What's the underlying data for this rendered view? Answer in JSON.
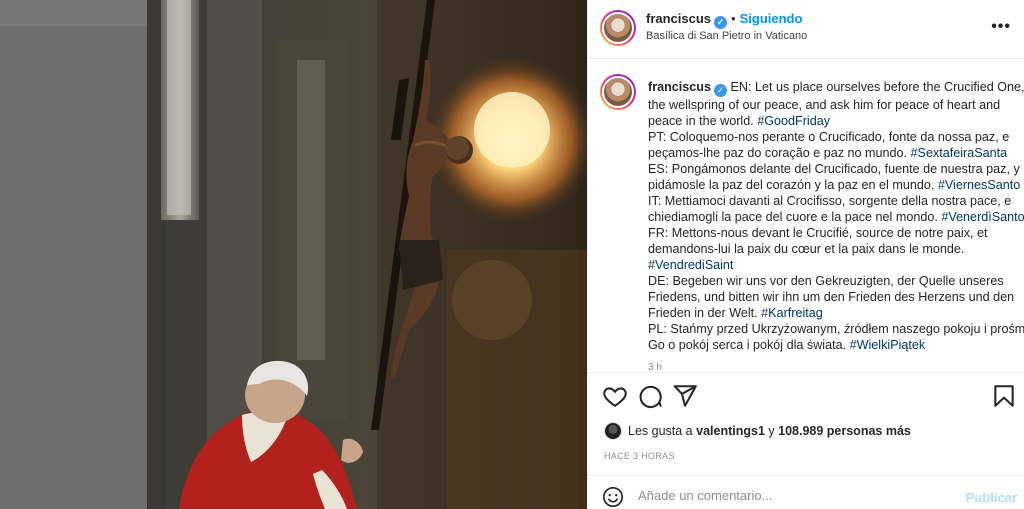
{
  "post": {
    "username": "franciscus",
    "follow_status": "Siguiendo",
    "separator": "•",
    "location": "Basílica di San Pietro in Vaticano",
    "more_icon": "more-horizontal-icon"
  },
  "caption": {
    "username": "franciscus",
    "lines": [
      {
        "text": "EN: Let us place ourselves before the Crucified One,",
        "tag": ""
      },
      {
        "text": "the wellspring of our peace, and ask him for peace of heart and",
        "tag": ""
      },
      {
        "text": "peace in the world. ",
        "tag": "#GoodFriday"
      },
      {
        "text": "PT: Coloquemo-nos perante o Crucificado, fonte da nossa paz, e",
        "tag": ""
      },
      {
        "text": "peçamos-lhe paz do coração e paz no mundo. ",
        "tag": "#SextafeiraSanta"
      },
      {
        "text": "ES: Pongámonos delante del Crucificado, fuente de nuestra paz, y",
        "tag": ""
      },
      {
        "text": "pidámosle la paz del corazón y la paz en el mundo. ",
        "tag": "#ViernesSanto"
      },
      {
        "text": "IT: Mettiamoci davanti al Crocifisso, sorgente della nostra pace, e",
        "tag": ""
      },
      {
        "text": "chiediamogli la pace del cuore e la pace nel mondo. ",
        "tag": "#VenerdìSanto"
      },
      {
        "text": "FR: Mettons-nous devant le Crucifié, source de notre paix, et",
        "tag": ""
      },
      {
        "text": "demandons-lui la paix du cœur et la paix dans le monde.",
        "tag": ""
      },
      {
        "text": "",
        "tag": "#VendrediSaint"
      },
      {
        "text": "DE: Begeben wir uns vor den Gekreuzigten, der Quelle unseres",
        "tag": ""
      },
      {
        "text": "Friedens, und bitten wir ihn um den Frieden des Herzens und den",
        "tag": ""
      },
      {
        "text": "Frieden in der Welt. ",
        "tag": "#Karfreitag"
      },
      {
        "text": "PL: Stańmy przed Ukrzyżowanym, źródłem naszego pokoju i prośmy",
        "tag": ""
      },
      {
        "text": "Go o pokój serca i pokój dla świata. ",
        "tag": "#WielkiPiątek"
      }
    ],
    "cut_time": "3 h"
  },
  "actions": {
    "like_icon": "heart-icon",
    "comment_icon": "comment-bubble-icon",
    "share_icon": "paper-plane-icon",
    "save_icon": "bookmark-icon"
  },
  "likes": {
    "prefix": "Les gusta a",
    "user": "valentings1",
    "connector": "y",
    "count": "108.989 personas más"
  },
  "time_ago": "HACE 3 HORAS",
  "comment": {
    "placeholder": "Añade un comentario...",
    "publish_label": "Publicar",
    "emoji_icon": "emoji-smile-icon"
  },
  "colors": {
    "link_blue": "#0095f6",
    "hashtag": "#00376b",
    "verified": "#3897f0",
    "publish_disabled": "#b2dffc",
    "vestment_red": "#b3211c"
  }
}
